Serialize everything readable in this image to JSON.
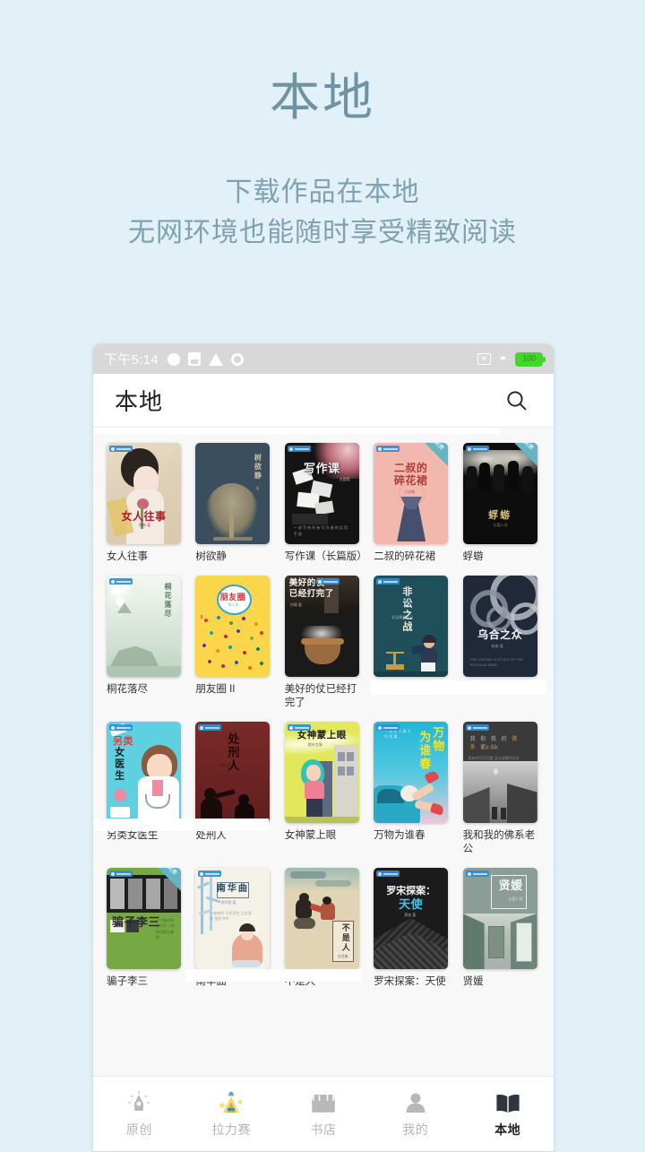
{
  "promo": {
    "title": "本地",
    "subtitle_line1": "下载作品在本地",
    "subtitle_line2": "无网环境也能随时享受精致阅读",
    "accent_color": "#6e93a3",
    "background_color": "#e2f0f7"
  },
  "statusbar": {
    "time": "下午5:14",
    "battery_level": "100",
    "left_icons": [
      "circle-icon",
      "sd-card-icon",
      "warning-icon",
      "ring-icon"
    ],
    "right_icons": [
      "no-sim-icon",
      "wifi-icon",
      "battery-icon"
    ]
  },
  "appbar": {
    "title": "本地",
    "search_icon": "search-icon"
  },
  "shelf": {
    "books": [
      {
        "title": "女人往事",
        "badge": "正版授权",
        "ribbon": ""
      },
      {
        "title": "树欲静",
        "badge": "",
        "ribbon": ""
      },
      {
        "title": "写作课（长篇版）",
        "badge": "正版授权",
        "ribbon": ""
      },
      {
        "title": "二叔的碎花裙",
        "badge": "正版授权",
        "ribbon": "免费"
      },
      {
        "title": "蜉蝣",
        "badge": "正版授权",
        "ribbon": "免费"
      },
      {
        "title": "桐花落尽",
        "badge": "正版授权",
        "ribbon": ""
      },
      {
        "title": "朋友圈 II",
        "badge": "",
        "ribbon": ""
      },
      {
        "title": "美好的仗已经打完了",
        "badge": "正版授权",
        "ribbon": ""
      },
      {
        "title": "非讼之战",
        "badge": "正版授权",
        "ribbon": ""
      },
      {
        "title": "乌合之众",
        "badge": "",
        "ribbon": ""
      },
      {
        "title": "另类女医生",
        "badge": "正版授权",
        "ribbon": ""
      },
      {
        "title": "处刑人",
        "badge": "正版授权",
        "ribbon": ""
      },
      {
        "title": "女神蒙上眼",
        "badge": "正版授权",
        "ribbon": ""
      },
      {
        "title": "万物为谁春",
        "badge": "正版授权",
        "ribbon": ""
      },
      {
        "title": "我和我的佛系老公",
        "badge": "正版授权",
        "ribbon": ""
      },
      {
        "title": "骗子李三",
        "badge": "正版授权",
        "ribbon": "免费"
      },
      {
        "title": "南华曲",
        "badge": "正版授权",
        "ribbon": ""
      },
      {
        "title": "不是人",
        "badge": "",
        "ribbon": ""
      },
      {
        "title": "罗宋探案：天使",
        "badge": "正版授权",
        "ribbon": ""
      },
      {
        "title": "贤媛",
        "badge": "正版授权",
        "ribbon": ""
      }
    ],
    "cover_texts": {
      "b0": "女人往事",
      "b1": "树欲静",
      "b2": "写作课",
      "b3a": "二叔的",
      "b3b": "碎花裙",
      "b4": "蜉蝣",
      "b5": "桐花落尽",
      "b6": "朋友圈",
      "b7a": "美好的仗",
      "b7b": "已经打完了",
      "b8": "非讼之战",
      "b9": "乌合之众",
      "b10a": "另类",
      "b10b": "女医生",
      "b11": "处刑人",
      "b12": "女神蒙上眼",
      "b13a": "万物",
      "b13b": "为谁春",
      "b15": "骗子李三",
      "b16": "南华曲",
      "b17": "不是人",
      "b18a": "罗宋探案：",
      "b18b": "天使",
      "b19": "贤媛"
    }
  },
  "nav": {
    "items": [
      {
        "label": "原创",
        "icon": "pen-nib-icon",
        "active": false
      },
      {
        "label": "拉力赛",
        "icon": "trophy-icon",
        "active": false
      },
      {
        "label": "书店",
        "icon": "store-icon",
        "active": false
      },
      {
        "label": "我的",
        "icon": "person-icon",
        "active": false
      },
      {
        "label": "本地",
        "icon": "open-book-icon",
        "active": true
      }
    ]
  }
}
